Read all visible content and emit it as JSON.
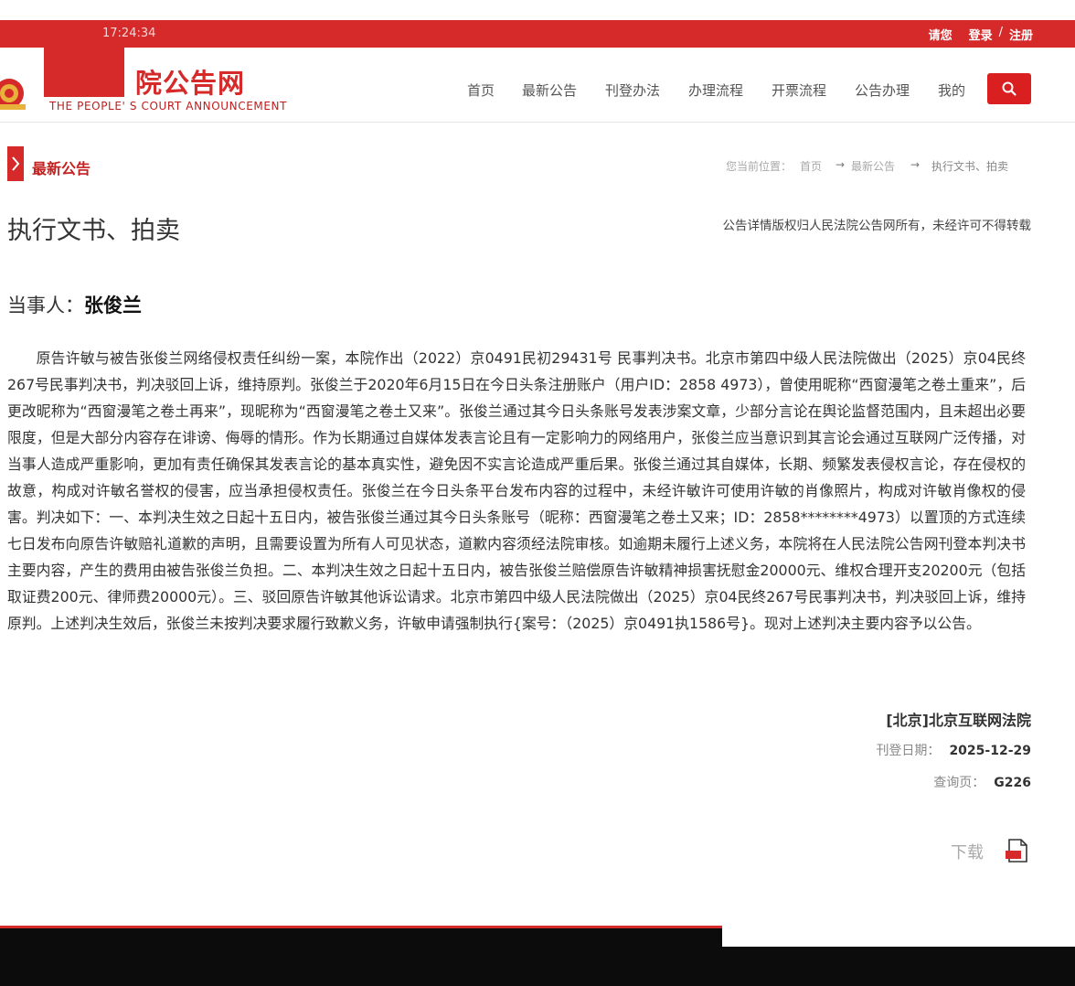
{
  "top_bar": {
    "time": "17:24:34",
    "greeting": "请您",
    "login": "登录",
    "separator": "/",
    "register": "注册"
  },
  "header": {
    "logo_text": "院公告网",
    "logo_english": "THE PEOPLE' S COURT ANNOUNCEMENT",
    "nav": [
      "首页",
      "最新公告",
      "刊登办法",
      "办理流程",
      "开票流程",
      "公告办理",
      "我的"
    ],
    "search_icon": "search-icon"
  },
  "section": {
    "title": "最新公告",
    "breadcrumb": {
      "prefix": "您当前位置：",
      "home": "首页",
      "arrow": "→",
      "latest": "最新公告",
      "current": "执行文书、拍卖"
    }
  },
  "notice": {
    "title": "执行文书、拍卖",
    "copyright": "公告详情版权归人民法院公告网所有，未经许可不得转载",
    "party_label": "当事人：",
    "party_name": "张俊兰",
    "body": "原告许敏与被告张俊兰网络侵权责任纠纷一案，本院作出（2022）京0491民初29431号 民事判决书。北京市第四中级人民法院做出（2025）京04民终267号民事判决书，判决驳回上诉，维持原判。张俊兰于2020年6月15日在今日头条注册账户（用户ID：2858 4973），曾使用昵称“西窗漫笔之卷土重来”，后更改昵称为“西窗漫笔之卷土再来”，现昵称为“西窗漫笔之卷土又来”。张俊兰通过其今日头条账号发表涉案文章，少部分言论在舆论监督范围内，且未超出必要限度，但是大部分内容存在诽谤、侮辱的情形。作为长期通过自媒体发表言论且有一定影响力的网络用户，张俊兰应当意识到其言论会通过互联网广泛传播，对当事人造成严重影响，更加有责任确保其发表言论的基本真实性，避免因不实言论造成严重后果。张俊兰通过其自媒体，长期、频繁发表侵权言论，存在侵权的故意，构成对许敏名誉权的侵害，应当承担侵权责任。张俊兰在今日头条平台发布内容的过程中，未经许敏许可使用许敏的肖像照片，构成对许敏肖像权的侵害。判决如下：一、本判决生效之日起十五日内，被告张俊兰通过其今日头条账号（昵称：西窗漫笔之卷土又来；ID：2858********4973）以置顶的方式连续七日发布向原告许敏赔礼道歉的声明，且需要设置为所有人可见状态，道歉内容须经法院审核。如逾期未履行上述义务，本院将在人民法院公告网刊登本判决书主要内容，产生的费用由被告张俊兰负担。二、本判决生效之日起十五日内，被告张俊兰赔偿原告许敏精神损害抚慰金20000元、维权合理开支20200元（包括取证费200元、律师费20000元）。三、驳回原告许敏其他诉讼请求。北京市第四中级人民法院做出（2025）京04民终267号民事判决书，判决驳回上诉，维持原判。上述判决生效后，张俊兰未按判决要求履行致歉义务，许敏申请强制执行{案号：（2025）京0491执1586号}。现对上述判决主要内容予以公告。",
    "court": "[北京]北京互联网法院",
    "date_label": "刊登日期：",
    "date": "2025-12-29",
    "page_label": "查询页：",
    "page": "G226",
    "download": "下载",
    "download_icon": "pdf-file-icon"
  },
  "colors": {
    "brand_red": "#d62a2a",
    "search_red": "#d91f1f"
  }
}
